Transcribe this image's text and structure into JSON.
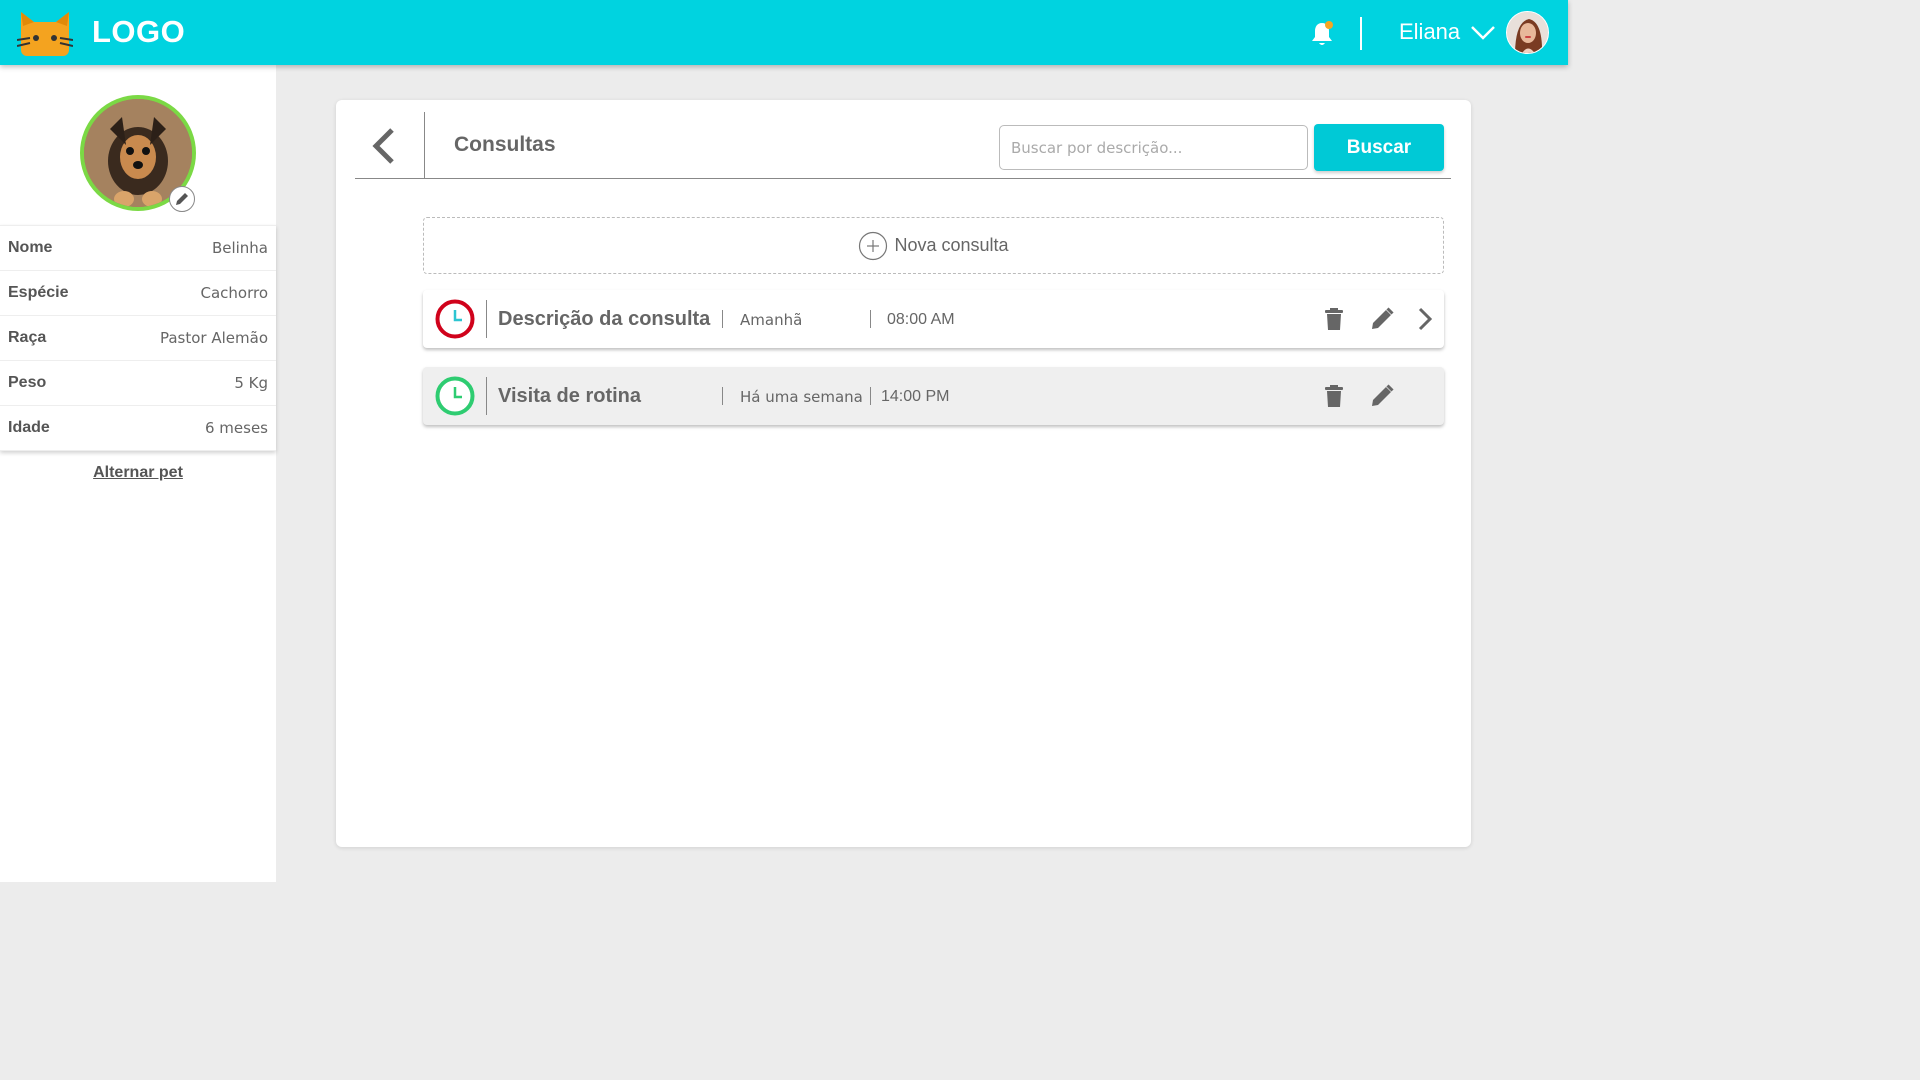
{
  "header": {
    "logo_text": "LOGO",
    "user_name": "Eliana",
    "brand_color": "#00d3e0"
  },
  "pet": {
    "fields": [
      {
        "label": "Nome",
        "value": "Belinha"
      },
      {
        "label": "Espécie",
        "value": "Cachorro"
      },
      {
        "label": "Raça",
        "value": "Pastor Alemão"
      },
      {
        "label": "Peso",
        "value": "5 Kg"
      },
      {
        "label": "Idade",
        "value": "6 meses"
      }
    ],
    "switch_label": "Alternar pet"
  },
  "main": {
    "title": "Consultas",
    "search_placeholder": "Buscar por descrição...",
    "search_button": "Buscar",
    "new_label": "Nova consulta",
    "consultations": [
      {
        "description": "Descrição da consulta",
        "date": "Amanhã",
        "time": "08:00 AM",
        "status_color": "#d0021b"
      },
      {
        "description": "Visita de rotina",
        "date": "Há uma semana",
        "time": "14:00 PM",
        "status_color": "#2ecc71"
      }
    ]
  }
}
